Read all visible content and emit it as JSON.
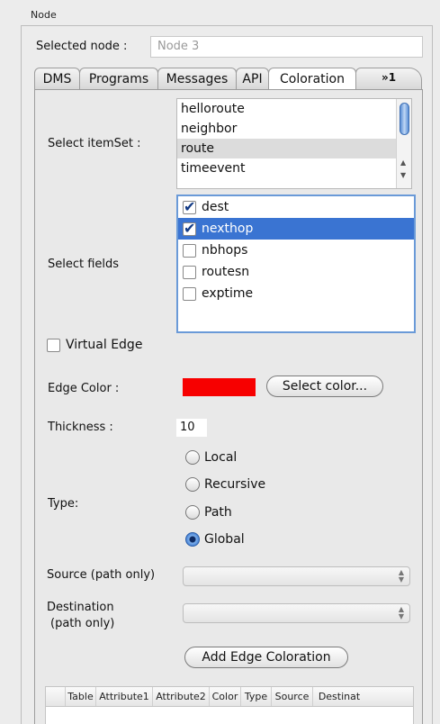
{
  "panel": {
    "title": "Node"
  },
  "selected_node": {
    "label": "Selected node :",
    "value": "Node 3"
  },
  "tabs": [
    {
      "label": "DMS",
      "active": false
    },
    {
      "label": "Programs",
      "active": false
    },
    {
      "label": "Messages",
      "active": false
    },
    {
      "label": "API",
      "active": false
    },
    {
      "label": "Coloration",
      "active": true
    }
  ],
  "tab_overflow": {
    "label": "»1"
  },
  "itemset": {
    "label": "Select itemSet :",
    "items": [
      {
        "label": "helloroute",
        "selected": false
      },
      {
        "label": "neighbor",
        "selected": false
      },
      {
        "label": "route",
        "selected": true
      },
      {
        "label": "timeevent",
        "selected": false
      }
    ]
  },
  "fields": {
    "label": "Select fields",
    "items": [
      {
        "label": "dest",
        "checked": true,
        "highlighted": false
      },
      {
        "label": "nexthop",
        "checked": true,
        "highlighted": true
      },
      {
        "label": "nbhops",
        "checked": false,
        "highlighted": false
      },
      {
        "label": "routesn",
        "checked": false,
        "highlighted": false
      },
      {
        "label": "exptime",
        "checked": false,
        "highlighted": false
      }
    ]
  },
  "virtual_edge": {
    "label": "Virtual Edge",
    "checked": false
  },
  "edge_color": {
    "label": "Edge Color :",
    "color": "#f70000",
    "button_label": "Select color..."
  },
  "thickness": {
    "label": "Thickness :",
    "value": "10"
  },
  "type": {
    "label": "Type:",
    "options": [
      {
        "label": "Local",
        "selected": false
      },
      {
        "label": "Recursive",
        "selected": false
      },
      {
        "label": "Path",
        "selected": false
      },
      {
        "label": "Global",
        "selected": true
      }
    ]
  },
  "source": {
    "label": "Source (path only)",
    "value": ""
  },
  "destination": {
    "label_line1": "Destination",
    "label_line2": "(path only)",
    "value": ""
  },
  "add_button": {
    "label": "Add Edge Coloration"
  },
  "table": {
    "columns": [
      "",
      "Table",
      "Attribute1",
      "Attribute2",
      "Color",
      "Type",
      "Source",
      "Destinat"
    ]
  }
}
